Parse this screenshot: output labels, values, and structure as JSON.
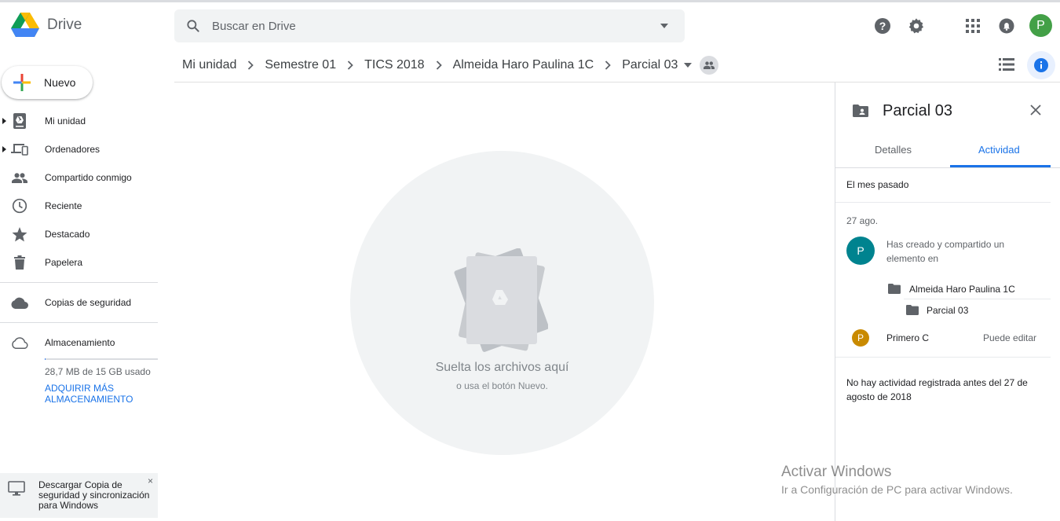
{
  "app": {
    "title": "Drive"
  },
  "search": {
    "placeholder": "Buscar en Drive"
  },
  "user": {
    "initial": "P"
  },
  "breadcrumb": [
    {
      "label": "Mi unidad"
    },
    {
      "label": "Semestre 01"
    },
    {
      "label": "TICS 2018"
    },
    {
      "label": "Almeida Haro Paulina 1C"
    },
    {
      "label": "Parcial 03"
    }
  ],
  "sidebar": {
    "new_label": "Nuevo",
    "items": [
      {
        "label": "Mi unidad",
        "icon": "drive-icon"
      },
      {
        "label": "Ordenadores",
        "icon": "computers-icon"
      },
      {
        "label": "Compartido conmigo",
        "icon": "people-icon"
      },
      {
        "label": "Reciente",
        "icon": "clock-icon"
      },
      {
        "label": "Destacado",
        "icon": "star-icon"
      },
      {
        "label": "Papelera",
        "icon": "trash-icon"
      },
      {
        "label": "Copias de seguridad",
        "icon": "cloud-icon"
      },
      {
        "label": "Almacenamiento",
        "icon": "cloud-outline-icon"
      }
    ],
    "storage": {
      "used_text": "28,7 MB de 15 GB usado",
      "fraction_used": 0.0019,
      "buy_label": "ADQUIRIR MÁS ALMACENAMIENTO"
    },
    "download_card": {
      "text": "Descargar Copia de seguridad y sincronización para Windows",
      "close": "×"
    }
  },
  "main": {
    "drop_title": "Suelta los archivos aquí",
    "drop_subtitle": "o usa el botón Nuevo."
  },
  "panel": {
    "title": "Parcial 03",
    "tabs": [
      {
        "label": "Detalles",
        "active": false
      },
      {
        "label": "Actividad",
        "active": true
      }
    ],
    "period": "El mes pasado",
    "activity": {
      "date": "27 ago.",
      "avatar": "P",
      "text": "Has creado y compartido un elemento en",
      "parent_folder": "Almeida Haro Paulina 1C",
      "child_folder": "Parcial 03",
      "permission": {
        "avatar": "P",
        "name": "Primero C",
        "role": "Puede editar"
      }
    },
    "no_activity": "No hay actividad registrada antes del 27 de agosto de 2018"
  },
  "watermark": {
    "title": "Activar Windows",
    "subtitle": "Ir a Configuración de PC para activar Windows."
  },
  "colors": {
    "accent": "#1a73e8",
    "avatar_top": "#43a047",
    "avatar_activity": "#00838f",
    "avatar_permission": "#c98a00"
  }
}
